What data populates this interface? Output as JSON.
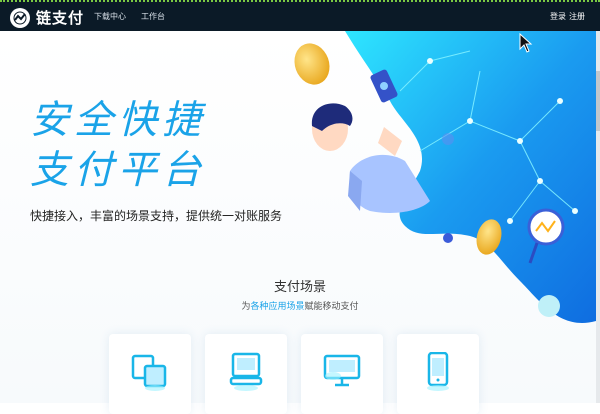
{
  "nav": {
    "logo_text": "链支付",
    "links": [
      "下载中心",
      "工作台"
    ],
    "login": "登录",
    "register": "注册"
  },
  "hero": {
    "title_line1": "安全快捷",
    "title_line2": "支付平台",
    "subtitle": "快捷接入，丰富的场景支持，提供统一对账服务"
  },
  "section": {
    "title": "支付场景",
    "sub_prefix": "为",
    "sub_highlight": "各种应用场景",
    "sub_suffix": "赋能移动支付"
  },
  "cards": [
    "app-scene-icon",
    "pc-scene-icon",
    "web-scene-icon",
    "mobile-scene-icon"
  ],
  "colors": {
    "accent": "#1aa3e8",
    "nav_bg": "#0b1a27"
  }
}
